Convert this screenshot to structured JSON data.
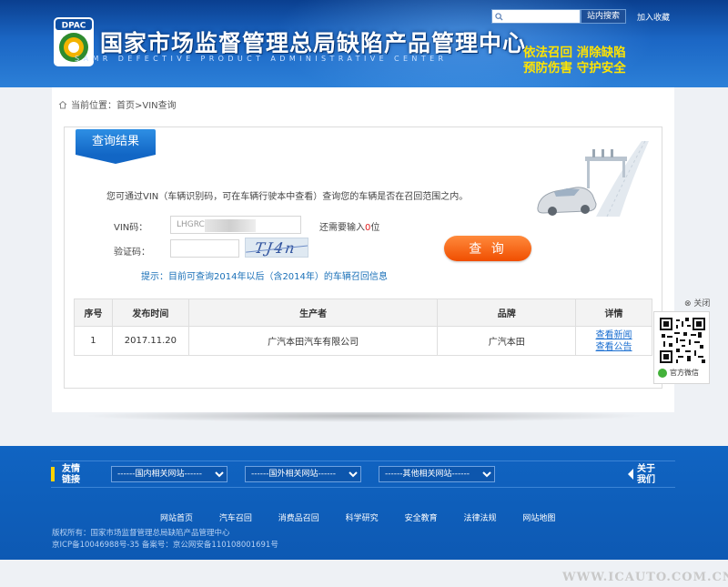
{
  "header": {
    "logo_text": "DPAC",
    "title": "国家市场监督管理总局缺陷产品管理中心",
    "subtitle": "SAMR DEFECTIVE PRODUCT ADMINISTRATIVE CENTER",
    "search": {
      "placeholder": "",
      "button_label": "站内搜索"
    },
    "favorite_label": "加入收藏",
    "slogan_line1": "依法召回  消除缺陷",
    "slogan_line2": "预防伤害  守护安全"
  },
  "breadcrumb": "当前位置：首页>VIN查询",
  "tab_label": "查询结果",
  "form": {
    "intro": "您可通过VIN（车辆识别码，可在车辆行驶本中查看）查询您的车辆是否在召回范围之内。",
    "vin_label": "VIN码：",
    "vin_value": "LHGRC3",
    "remain_prefix": "还需要输入",
    "remain_count": "0",
    "remain_suffix": "位",
    "captcha_label": "验证码：",
    "captcha_value": "",
    "captcha_text": "TJ4n",
    "submit_label": "查 询",
    "hint": "提示：目前可查询2014年以后（含2014年）的车辆召回信息"
  },
  "table": {
    "headers": [
      "序号",
      "发布时间",
      "生产者",
      "品牌",
      "详情"
    ],
    "rows": [
      {
        "index": "1",
        "date": "2017.11.20",
        "producer": "广汽本田汽车有限公司",
        "brand": "广汽本田",
        "link1": "查看新闻",
        "link2": "查看公告"
      }
    ]
  },
  "side": {
    "close_label": "关闭",
    "wechat_label": "官方微信"
  },
  "footer": {
    "links_title_1": "友情",
    "links_title_2": "链接",
    "select_domestic": "------国内相关网站------",
    "select_foreign": "------国外相关网站------",
    "select_other": "------其他相关网站------",
    "about_1": "关于",
    "about_2": "我们",
    "nav": [
      "网站首页",
      "汽车召回",
      "消费品召回",
      "科学研究",
      "安全教育",
      "法律法规",
      "网站地图"
    ],
    "copyright": "版权所有：国家市场监督管理总局缺陷产品管理中心",
    "icp": "京ICP备10046988号-35 备案号：京公网安备110108001691号"
  },
  "watermark": "WWW.ICAUTO.COM.CN",
  "colors": {
    "accent_blue": "#1266c5",
    "query_orange": "#f04e00",
    "slogan_yellow": "#ffe400",
    "footer_blue": "#0d59b3"
  }
}
